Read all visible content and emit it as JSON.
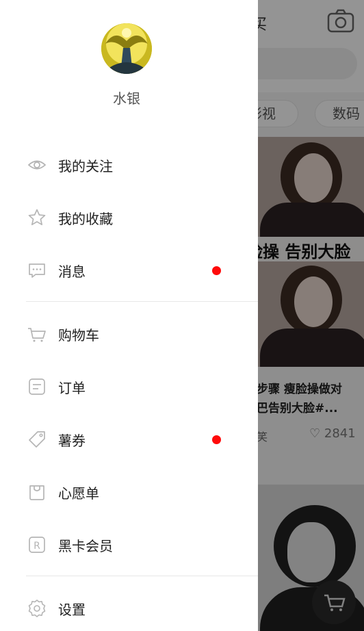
{
  "profile": {
    "name": "水银"
  },
  "menu_group1": [
    {
      "label": "我的关注",
      "icon": "eye-icon"
    },
    {
      "label": "我的收藏",
      "icon": "star-icon"
    },
    {
      "label": "消息",
      "icon": "message-icon",
      "badge": true
    }
  ],
  "menu_group2": [
    {
      "label": "购物车",
      "icon": "cart-icon"
    },
    {
      "label": "订单",
      "icon": "order-icon"
    },
    {
      "label": "薯券",
      "icon": "coupon-icon",
      "badge": true
    },
    {
      "label": "心愿单",
      "icon": "wishlist-icon"
    },
    {
      "label": "黑卡会员",
      "icon": "black-card-icon"
    }
  ],
  "menu_group3": [
    {
      "label": "设置",
      "icon": "settings-icon"
    }
  ],
  "background": {
    "top_text": "买",
    "chips": [
      "影视",
      "数码"
    ],
    "card1": {
      "caption": "脸操 告别大脸",
      "title_line1": "步骤 瘦脸操做对",
      "title_line2": "巴告别大脸#...",
      "author": "笑",
      "likes": "2841"
    }
  },
  "colors": {
    "badge": "#ff0a0a",
    "icon": "#b5b5b5",
    "text": "#222222"
  }
}
